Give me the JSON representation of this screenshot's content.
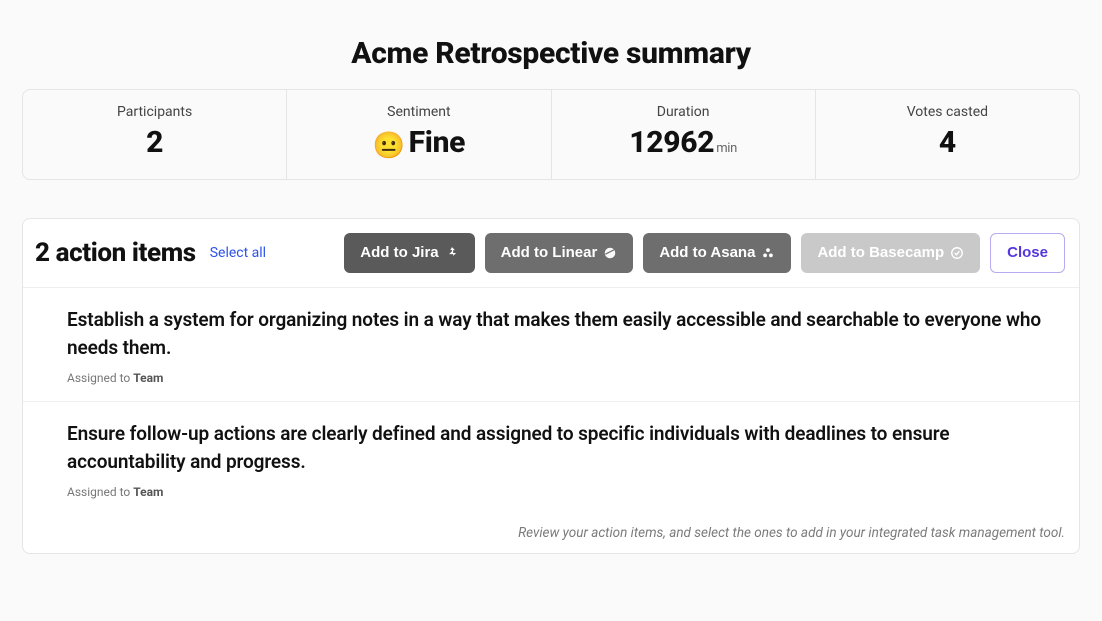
{
  "title": "Acme Retrospective summary",
  "stats": {
    "participants": {
      "label": "Participants",
      "value": "2"
    },
    "sentiment": {
      "label": "Sentiment",
      "emoji": "😐",
      "value": "Fine"
    },
    "duration": {
      "label": "Duration",
      "value": "12962",
      "unit": "min"
    },
    "votes": {
      "label": "Votes casted",
      "value": "4"
    }
  },
  "actions": {
    "heading": "2 action items",
    "select_all": "Select all",
    "buttons": {
      "jira": "Add to Jira",
      "linear": "Add to Linear",
      "asana": "Add to Asana",
      "basecamp": "Add to Basecamp",
      "close": "Close"
    },
    "items": [
      {
        "text": "Establish a system for organizing notes in a way that makes them easily accessible and searchable to everyone who needs them.",
        "assigned_prefix": "Assigned to ",
        "assignee": "Team"
      },
      {
        "text": "Ensure follow-up actions are clearly defined and assigned to specific individuals with deadlines to ensure accountability and progress.",
        "assigned_prefix": "Assigned to ",
        "assignee": "Team"
      }
    ],
    "footer": "Review your action items, and select the ones to add in your integrated task management tool."
  }
}
